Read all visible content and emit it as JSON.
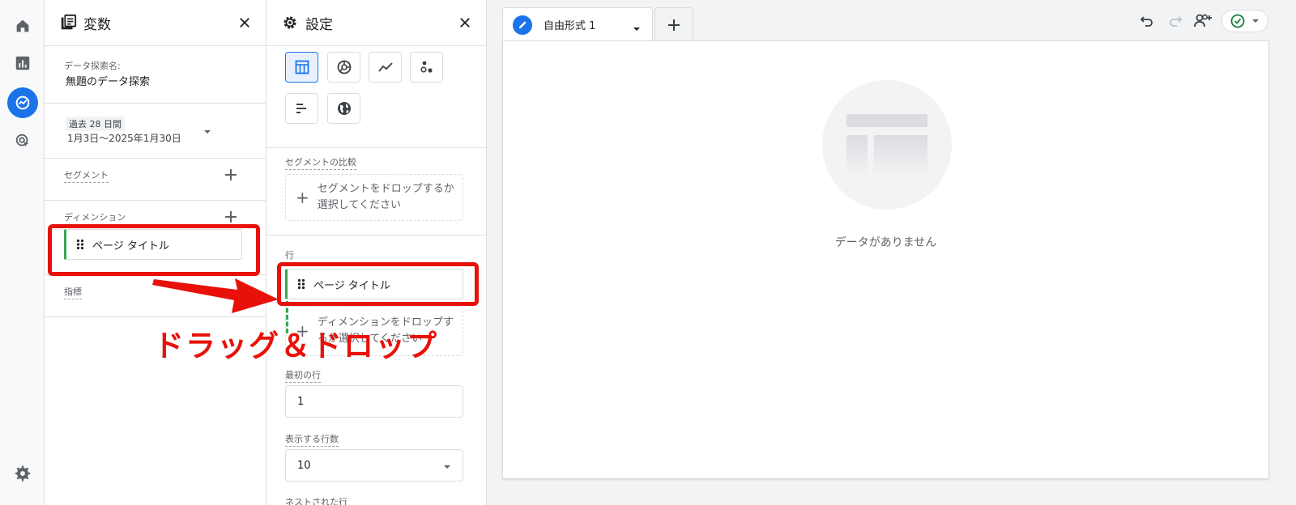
{
  "variables_panel": {
    "title": "変数",
    "exploration_name_label": "データ探索名:",
    "exploration_name_value": "無題のデータ探索",
    "date_range": {
      "badge": "過去 28 日間",
      "range": "1月3日～2025年1月30日"
    },
    "segments_label": "セグメント",
    "dimensions_label": "ディメンション",
    "dimension_chip": "ページ タイトル",
    "metrics_label": "指標"
  },
  "settings_panel": {
    "title": "設定",
    "segment_compare_label": "セグメントの比較",
    "segment_drop_text": "セグメントをドロップするか選択してください",
    "rows_label": "行",
    "row_chip": "ページ タイトル",
    "dimension_drop_text": "ディメンションをドロップするか選択してください",
    "first_row_label": "最初の行",
    "first_row_value": "1",
    "rows_to_show_label": "表示する行数",
    "rows_to_show_value": "10",
    "nested_rows_label": "ネストされた行"
  },
  "canvas": {
    "tab_label": "自由形式 1",
    "empty_text": "データがありません"
  },
  "annotation": {
    "text": "ドラッグ＆ドロップ"
  },
  "colors": {
    "accent": "#1a73e8",
    "highlight_red": "#e8110a",
    "chip_green": "#34a853",
    "status_green": "#188038"
  },
  "icons": {
    "rail": [
      "home-icon",
      "reports-icon",
      "explore-icon",
      "advertising-icon",
      "settings-gear-icon"
    ],
    "viz": [
      "table-icon",
      "donut-chart-icon",
      "line-chart-icon",
      "scatter-icon",
      "bar-chart-icon",
      "globe-icon"
    ],
    "toolbar": [
      "undo-icon",
      "redo-icon",
      "share-icon",
      "check-circle-icon"
    ]
  }
}
